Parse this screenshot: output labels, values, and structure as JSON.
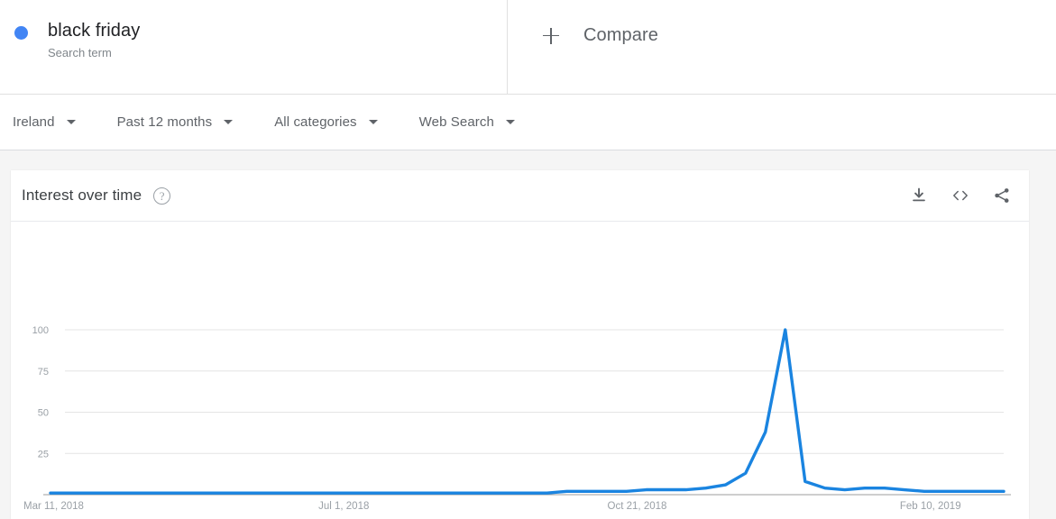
{
  "term": {
    "name": "black friday",
    "type_label": "Search term",
    "dot_color": "#4285f4"
  },
  "compare": {
    "label": "Compare",
    "icon": "plus-icon"
  },
  "filters": [
    {
      "label": "Ireland",
      "name": "location"
    },
    {
      "label": "Past 12 months",
      "name": "time-range"
    },
    {
      "label": "All categories",
      "name": "category"
    },
    {
      "label": "Web Search",
      "name": "search-type"
    }
  ],
  "card": {
    "title": "Interest over time",
    "help_icon": "help-circle-icon",
    "help_glyph": "?",
    "actions": [
      {
        "name": "download-icon"
      },
      {
        "name": "embed-icon"
      },
      {
        "name": "share-icon"
      }
    ]
  },
  "chart_data": {
    "type": "line",
    "title": "Interest over time",
    "xlabel": "",
    "ylabel": "",
    "series_name": "black friday",
    "line_color": "#1a84e0",
    "grid": true,
    "legend": false,
    "ylim": [
      0,
      100
    ],
    "yticks": [
      100,
      75,
      50,
      25
    ],
    "xticks": [
      "Mar 11, 2018",
      "Jul 1, 2018",
      "Oct 21, 2018",
      "Feb 10, 2019"
    ],
    "xtick_positions": [
      0,
      0.3077,
      0.6154,
      0.9231
    ],
    "x_start": "Mar 11, 2018",
    "x_end": "Feb 10, 2019",
    "x": [
      "Mar 11, 2018",
      "Mar 18, 2018",
      "Mar 25, 2018",
      "Apr 1, 2018",
      "Apr 8, 2018",
      "Apr 15, 2018",
      "Apr 22, 2018",
      "Apr 29, 2018",
      "May 6, 2018",
      "May 13, 2018",
      "May 20, 2018",
      "May 27, 2018",
      "Jun 3, 2018",
      "Jun 10, 2018",
      "Jun 17, 2018",
      "Jun 24, 2018",
      "Jul 1, 2018",
      "Jul 8, 2018",
      "Jul 15, 2018",
      "Jul 22, 2018",
      "Jul 29, 2018",
      "Aug 5, 2018",
      "Aug 12, 2018",
      "Aug 19, 2018",
      "Aug 26, 2018",
      "Sep 2, 2018",
      "Sep 9, 2018",
      "Sep 16, 2018",
      "Sep 23, 2018",
      "Sep 30, 2018",
      "Oct 7, 2018",
      "Oct 14, 2018",
      "Oct 21, 2018",
      "Oct 28, 2018",
      "Nov 4, 2018",
      "Nov 11, 2018",
      "Nov 18, 2018",
      "Nov 25, 2018",
      "Dec 2, 2018",
      "Dec 9, 2018",
      "Dec 16, 2018",
      "Dec 23, 2018",
      "Dec 30, 2018",
      "Jan 6, 2019",
      "Jan 13, 2019",
      "Jan 20, 2019",
      "Jan 27, 2019",
      "Feb 3, 2019",
      "Feb 10, 2019"
    ],
    "values": [
      1,
      1,
      1,
      1,
      1,
      1,
      1,
      1,
      1,
      1,
      1,
      1,
      1,
      1,
      1,
      1,
      1,
      1,
      1,
      1,
      1,
      1,
      1,
      1,
      1,
      1,
      2,
      2,
      2,
      2,
      3,
      3,
      3,
      4,
      6,
      13,
      38,
      100,
      8,
      4,
      3,
      4,
      4,
      3,
      2,
      2,
      2,
      2,
      2
    ],
    "peak": {
      "label": "Nov 25, 2018",
      "value": 100
    }
  }
}
